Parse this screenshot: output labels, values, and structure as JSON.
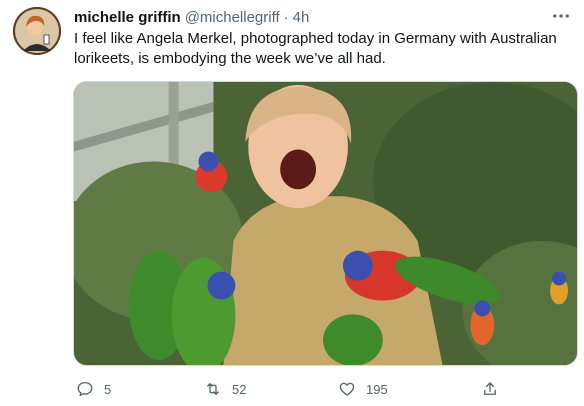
{
  "tweet": {
    "author": {
      "display_name": "michelle griffin",
      "handle": "@michellegriff",
      "separator": "·",
      "time": "4h"
    },
    "text": "I feel like Angela Merkel, photographed today in Germany with Australian lorikeets, is embodying the week we’ve all had.",
    "media": {
      "icon": "photo-icon"
    },
    "actions": {
      "reply": {
        "icon": "reply-icon",
        "count": "5"
      },
      "retweet": {
        "icon": "retweet-icon",
        "count": "52"
      },
      "like": {
        "icon": "heart-icon",
        "count": "195"
      },
      "share": {
        "icon": "share-icon"
      }
    },
    "more": {
      "icon": "more-icon"
    }
  },
  "colors": {
    "text": "#0f1419",
    "secondary": "#536471",
    "border": "#cfd9de"
  }
}
